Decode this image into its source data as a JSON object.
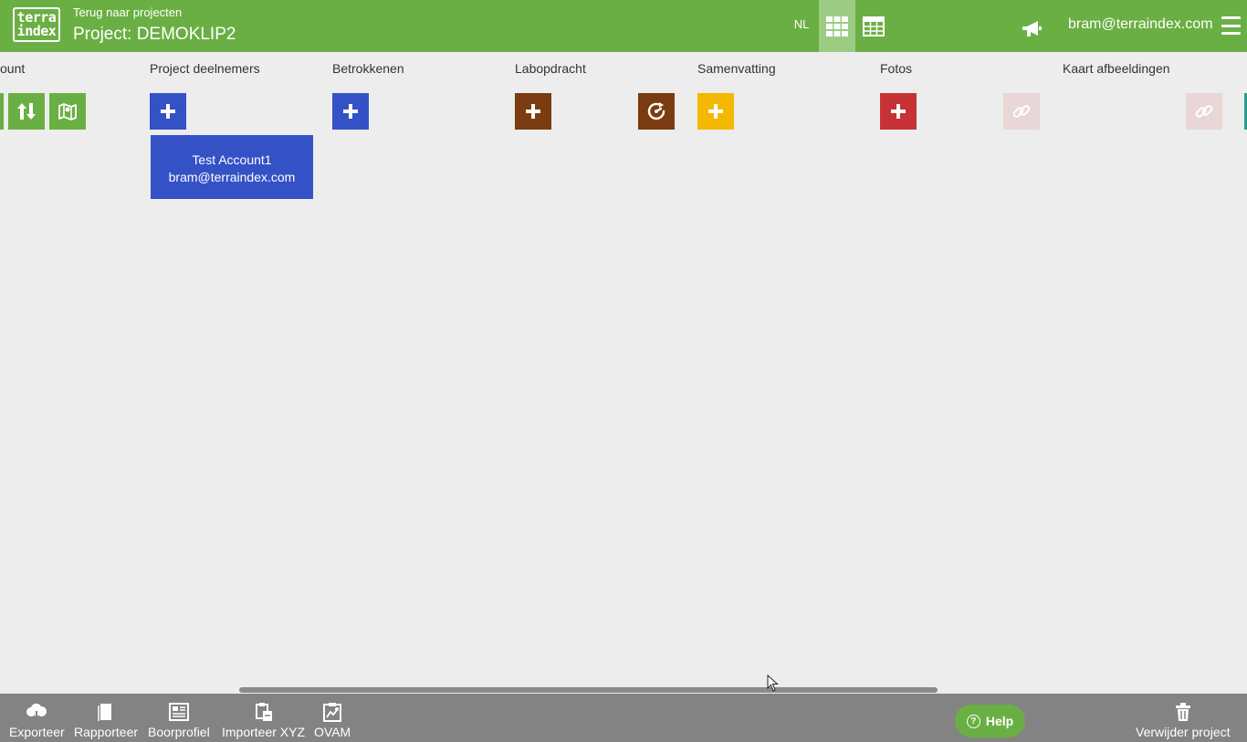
{
  "header": {
    "back_link": "Terug naar projecten",
    "project_title": "Project: DEMOKLIP2",
    "logo_top": "terra",
    "logo_bottom": "index",
    "language": "NL",
    "user_email": "bram@terraindex.com"
  },
  "columns": [
    {
      "title": "ount"
    },
    {
      "title": "Project deelnemers"
    },
    {
      "title": "Betrokkenen"
    },
    {
      "title": "Labopdracht"
    },
    {
      "title": "Samenvatting"
    },
    {
      "title": "Fotos"
    },
    {
      "title": "Kaart afbeeldingen"
    }
  ],
  "participant_card": {
    "name": "Test Account1",
    "email": "bram@terraindex.com"
  },
  "footer": {
    "buttons": [
      {
        "label": "Exporteer",
        "icon": "cloud-download-icon"
      },
      {
        "label": "Rapporteer",
        "icon": "document-icon"
      },
      {
        "label": "Boorprofiel",
        "icon": "profile-icon"
      },
      {
        "label": "Importeer XYZ",
        "icon": "import-icon"
      },
      {
        "label": "OVAM",
        "icon": "clipboard-map-icon"
      }
    ],
    "help_label": "Help",
    "delete_label": "Verwijder project"
  },
  "colors": {
    "header_green": "#6aaf43",
    "blue": "#3452c6",
    "brown": "#7a3c10",
    "yellow": "#f5b800",
    "red": "#c63236",
    "footer_gray": "#838383"
  }
}
